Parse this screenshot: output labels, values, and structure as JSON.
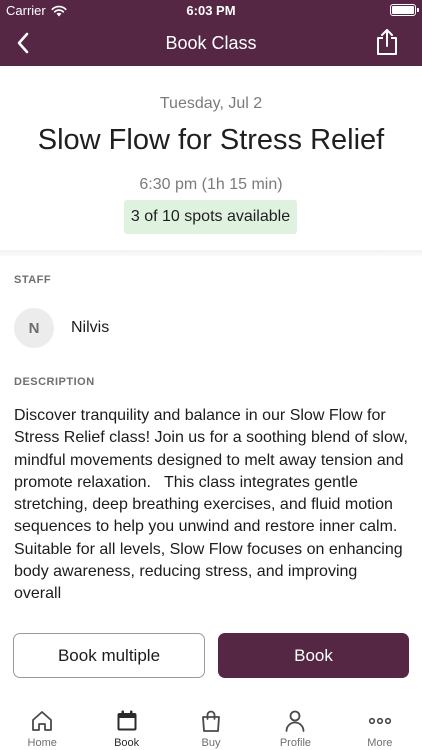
{
  "status_bar": {
    "carrier": "Carrier",
    "time": "6:03 PM"
  },
  "nav": {
    "title": "Book Class",
    "back_icon": "chevron-left-icon",
    "share_icon": "share-icon"
  },
  "class": {
    "date": "Tuesday, Jul 2",
    "title": "Slow Flow for Stress Relief",
    "time": "6:30 pm (1h 15 min)",
    "spots": "3 of 10 spots available"
  },
  "staff": {
    "section_label": "STAFF",
    "initial": "N",
    "name": "Nilvis"
  },
  "description": {
    "section_label": "DESCRIPTION",
    "text": "Discover tranquility and balance in our Slow Flow for Stress Relief class! Join us for a soothing blend of slow, mindful movements designed to melt away tension and promote relaxation.   This class integrates gentle stretching, deep breathing exercises, and fluid motion sequences to help you unwind and restore inner calm.   Suitable for all levels, Slow Flow focuses on enhancing body awareness, reducing stress, and improving overall"
  },
  "actions": {
    "book_multiple": "Book multiple",
    "book": "Book"
  },
  "tabs": [
    {
      "label": "Home",
      "icon": "home-icon",
      "active": false
    },
    {
      "label": "Book",
      "icon": "calendar-icon",
      "active": true
    },
    {
      "label": "Buy",
      "icon": "shopping-bag-icon",
      "active": false
    },
    {
      "label": "Profile",
      "icon": "person-icon",
      "active": false
    },
    {
      "label": "More",
      "icon": "more-icon",
      "active": false
    }
  ],
  "colors": {
    "brand": "#562744",
    "spots_bg": "#dff2e0"
  }
}
